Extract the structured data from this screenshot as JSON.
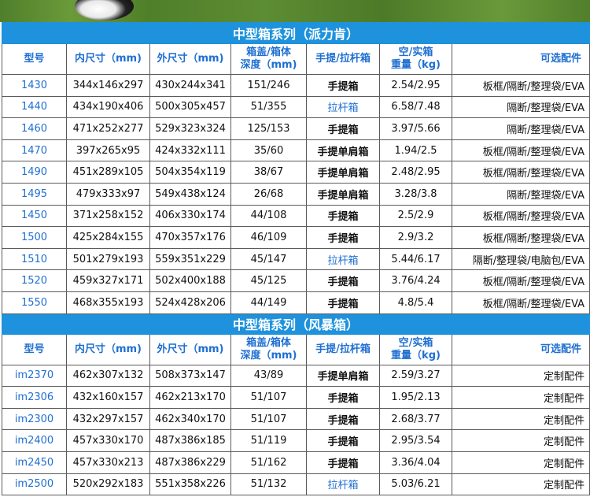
{
  "section1": {
    "title": "中型箱系列（派力肯）",
    "headers": [
      "型号",
      "内尺寸（mm)",
      "外尺寸（mm)",
      "箱盖/箱体",
      "深度（mm)",
      "手提/拉杆箱",
      "空/实箱",
      "重量（kg)",
      "可选配件"
    ],
    "rows": [
      {
        "model": "1430",
        "inner": "344x146x297",
        "outer": "430x244x341",
        "depth": "151/246",
        "carry": "手提箱",
        "weight": "2.54/2.95",
        "options": "板框/隔断/整理袋/EVA"
      },
      {
        "model": "1440",
        "inner": "434x190x406",
        "outer": "500x305x457",
        "depth": "51/355",
        "carry": "拉杆箱",
        "weight": "6.58/7.48",
        "options": "隔断/整理袋/EVA"
      },
      {
        "model": "1460",
        "inner": "471x252x277",
        "outer": "529x323x324",
        "depth": "125/153",
        "carry": "手提箱",
        "weight": "3.97/5.66",
        "options": "隔断/整理袋/EVA"
      },
      {
        "model": "1470",
        "inner": "397x265x95",
        "outer": "424x332x111",
        "depth": "35/60",
        "carry": "手提单肩箱",
        "weight": "1.94/2.5",
        "options": "板框/隔断/整理袋/EVA"
      },
      {
        "model": "1490",
        "inner": "451x289x105",
        "outer": "504x354x119",
        "depth": "38/67",
        "carry": "手提单肩箱",
        "weight": "2.48/2.95",
        "options": "板框/隔断/整理袋/EVA"
      },
      {
        "model": "1495",
        "inner": "479x333x97",
        "outer": "549x438x124",
        "depth": "26/68",
        "carry": "手提单肩箱",
        "weight": "3.28/3.8",
        "options": "隔断/整理袋/EVA"
      },
      {
        "model": "1450",
        "inner": "371x258x152",
        "outer": "406x330x174",
        "depth": "44/108",
        "carry": "手提箱",
        "weight": "2.5/2.9",
        "options": "板框/隔断/整理袋/EVA"
      },
      {
        "model": "1500",
        "inner": "425x284x155",
        "outer": "470x357x176",
        "depth": "46/109",
        "carry": "手提箱",
        "weight": "2.9/3.2",
        "options": "板框/隔断/整理袋/EVA"
      },
      {
        "model": "1510",
        "inner": "501x279x193",
        "outer": "559x351x229",
        "depth": "45/147",
        "carry": "拉杆箱",
        "weight": "5.44/6.17",
        "options": "隔断/整理袋/电脑包/EVA"
      },
      {
        "model": "1520",
        "inner": "459x327x171",
        "outer": "502x400x188",
        "depth": "45/125",
        "carry": "手提箱",
        "weight": "3.76/4.24",
        "options": "板框/隔断/整理袋/EVA"
      },
      {
        "model": "1550",
        "inner": "468x355x193",
        "outer": "524x428x206",
        "depth": "44/149",
        "carry": "手提箱",
        "weight": "4.8/5.4",
        "options": "板框/隔断/整理袋/EVA"
      }
    ]
  },
  "section2": {
    "title": "中型箱系列（风暴箱）",
    "headers": [
      "型号",
      "内尺寸（mm)",
      "外尺寸（mm)",
      "箱盖/箱体",
      "深度（mm)",
      "手提/拉杆箱",
      "空/实箱",
      "重量（kg)",
      "可选配件"
    ],
    "rows": [
      {
        "model": "im2370",
        "inner": "462x307x132",
        "outer": "508x373x147",
        "depth": "43/89",
        "carry": "手提单肩箱",
        "weight": "2.59/3.27",
        "options": "定制配件"
      },
      {
        "model": "im2306",
        "inner": "432x160x157",
        "outer": "462x213x170",
        "depth": "51/107",
        "carry": "手提箱",
        "weight": "1.95/2.13",
        "options": "定制配件"
      },
      {
        "model": "im2300",
        "inner": "432x297x157",
        "outer": "462x340x170",
        "depth": "51/107",
        "carry": "手提箱",
        "weight": "2.68/3.77",
        "options": "定制配件"
      },
      {
        "model": "im2400",
        "inner": "457x330x170",
        "outer": "487x386x185",
        "depth": "51/119",
        "carry": "手提箱",
        "weight": "2.95/3.54",
        "options": "定制配件"
      },
      {
        "model": "im2450",
        "inner": "457x330x213",
        "outer": "487x386x229",
        "depth": "51/162",
        "carry": "手提箱",
        "weight": "3.36/4.04",
        "options": "定制配件"
      },
      {
        "model": "im2500",
        "inner": "520x292x183",
        "outer": "551x358x226",
        "depth": "51/132",
        "carry": "拉杆箱",
        "weight": "5.03/6.21",
        "options": "定制配件"
      }
    ]
  },
  "colors": {
    "header_bg": "#1e92dc",
    "accent": "#1f6fd2"
  }
}
